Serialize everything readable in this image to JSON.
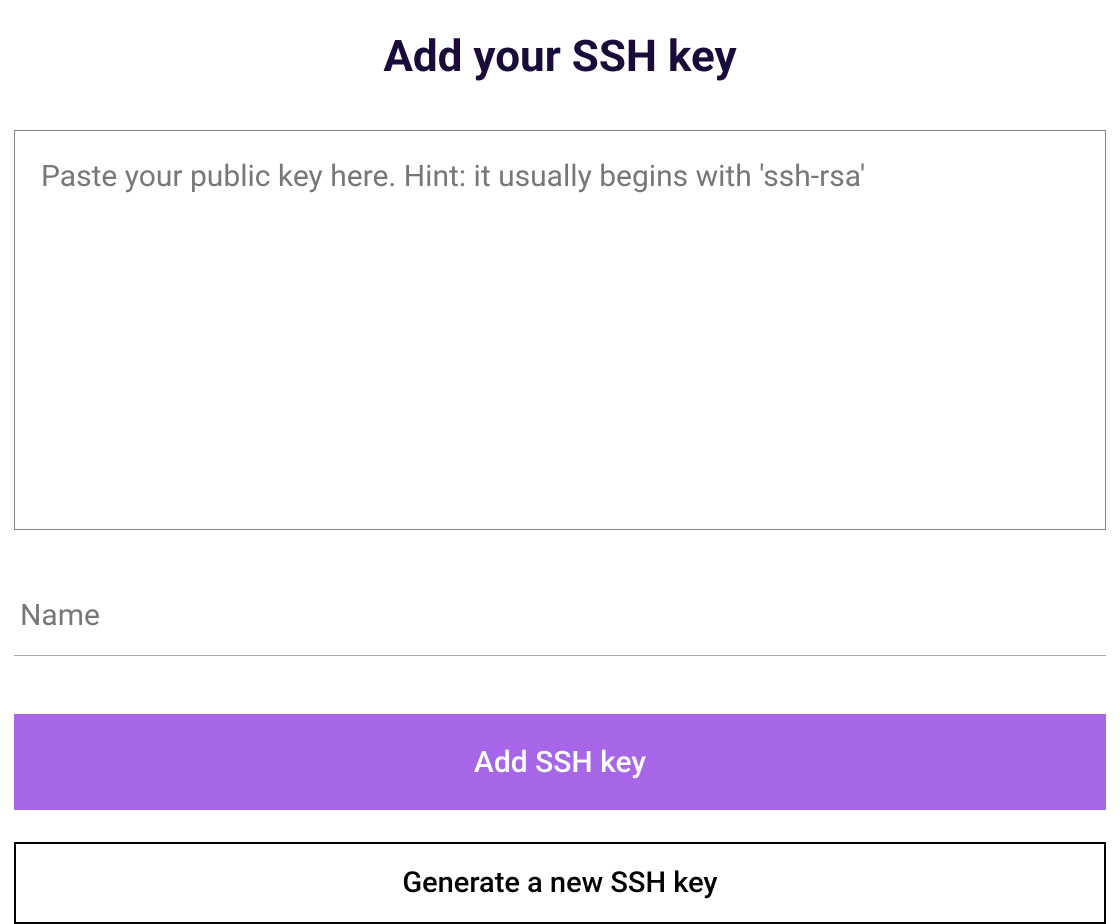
{
  "heading": "Add your SSH key",
  "form": {
    "ssh_key_textarea": {
      "placeholder": "Paste your public key here. Hint: it usually begins with 'ssh-rsa'",
      "value": ""
    },
    "name_input": {
      "placeholder": "Name",
      "value": ""
    },
    "add_button_label": "Add SSH key",
    "generate_button_label": "Generate a new SSH key"
  },
  "colors": {
    "heading_color": "#1a0b3a",
    "primary_button_bg": "#a766e8",
    "primary_button_text": "#ffffff",
    "secondary_button_border": "#000000"
  }
}
